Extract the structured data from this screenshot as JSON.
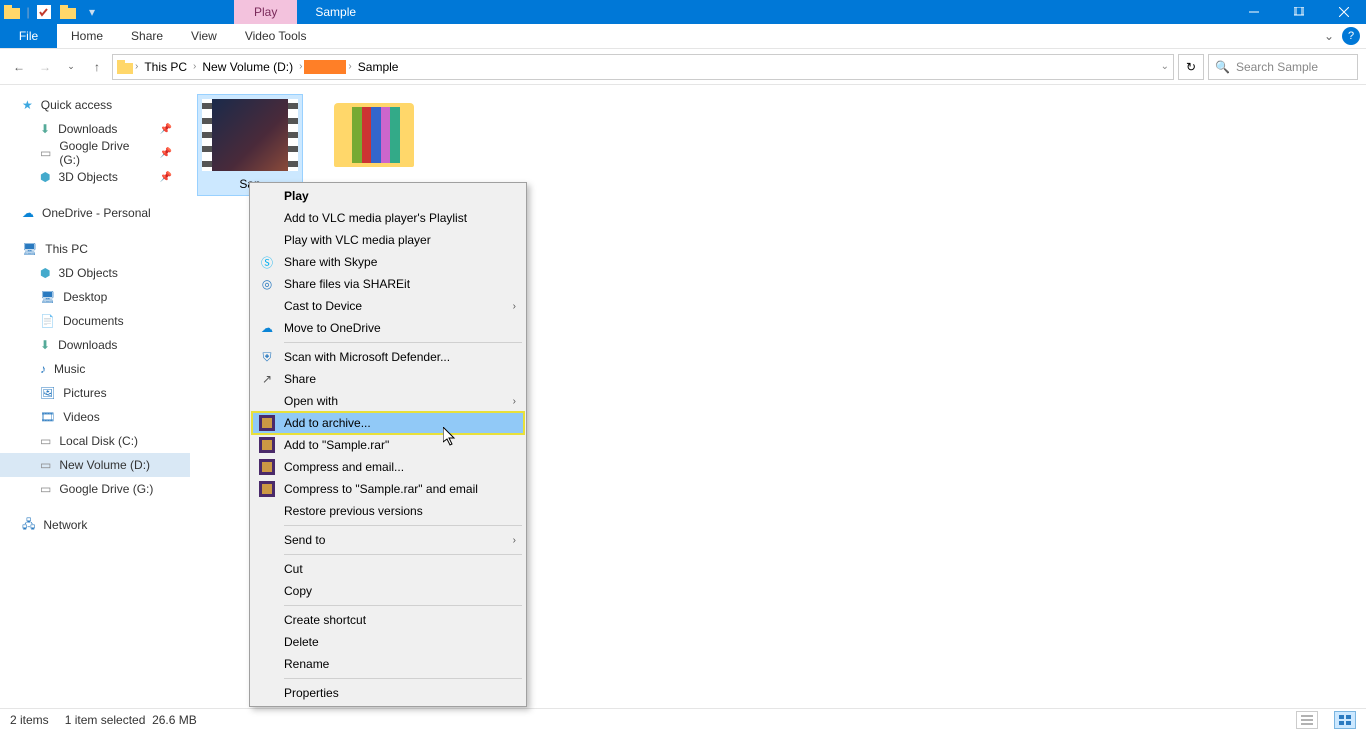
{
  "titlebar": {
    "tab_play": "Play",
    "title": "Sample"
  },
  "menubar": {
    "file": "File",
    "home": "Home",
    "share": "Share",
    "view": "View",
    "video_tools": "Video Tools"
  },
  "breadcrumb": {
    "root": "This PC",
    "vol": "New Volume (D:)",
    "leaf": "Sample"
  },
  "addressbar": {
    "refresh_title": "Refresh"
  },
  "search": {
    "placeholder": "Search Sample"
  },
  "sidebar": {
    "quick": "Quick access",
    "downloads": "Downloads",
    "gdrive": "Google Drive (G:)",
    "objects3d": "3D Objects",
    "onedrive": "OneDrive - Personal",
    "thispc": "This PC",
    "pc_3d": "3D Objects",
    "pc_desktop": "Desktop",
    "pc_documents": "Documents",
    "pc_downloads": "Downloads",
    "pc_music": "Music",
    "pc_pictures": "Pictures",
    "pc_videos": "Videos",
    "pc_c": "Local Disk (C:)",
    "pc_d": "New Volume (D:)",
    "pc_g": "Google Drive (G:)",
    "network": "Network"
  },
  "files": {
    "video": "San",
    "folder": ""
  },
  "context": {
    "play": "Play",
    "vlc_playlist": "Add to VLC media player's Playlist",
    "vlc_play": "Play with VLC media player",
    "skype": "Share with Skype",
    "shareit": "Share files via SHAREit",
    "cast": "Cast to Device",
    "onedrive": "Move to OneDrive",
    "defender": "Scan with Microsoft Defender...",
    "share": "Share",
    "openwith": "Open with",
    "archive": "Add to archive...",
    "archive_rar": "Add to \"Sample.rar\"",
    "compress_email": "Compress and email...",
    "compress_rar_email": "Compress to \"Sample.rar\" and email",
    "restore": "Restore previous versions",
    "sendto": "Send to",
    "cut": "Cut",
    "copy": "Copy",
    "shortcut": "Create shortcut",
    "delete": "Delete",
    "rename": "Rename",
    "properties": "Properties"
  },
  "status": {
    "items": "2 items",
    "selected": "1 item selected",
    "size": "26.6 MB"
  },
  "colors": {
    "accent": "#0078d7",
    "play_tab": "#f3c2dd",
    "redact": "#ff7f27",
    "highlight": "#91c9f7",
    "outline": "#e8e03a"
  }
}
